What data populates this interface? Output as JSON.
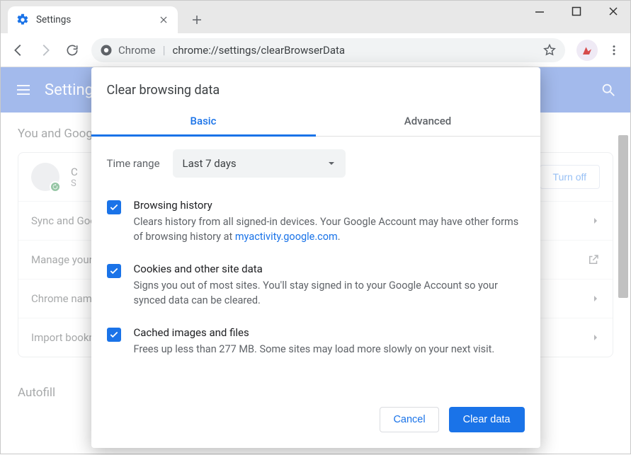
{
  "window": {
    "tab_title": "Settings"
  },
  "toolbar": {
    "url_prefix": "Chrome",
    "url_path": "chrome://settings/clearBrowserData"
  },
  "bluebar": {
    "title": "Settings"
  },
  "page": {
    "section_title": "You and Google",
    "profile_name_trunc": "C",
    "profile_sub_trunc": "S",
    "turn_off_label": "Turn off",
    "rows": [
      {
        "label": "Sync and Google services"
      },
      {
        "label": "Manage your Google Account"
      },
      {
        "label": "Chrome name and picture"
      },
      {
        "label": "Import bookmarks and settings"
      }
    ],
    "autofill_title": "Autofill"
  },
  "dialog": {
    "title": "Clear browsing data",
    "tabs": {
      "basic": "Basic",
      "advanced": "Advanced"
    },
    "time_range_label": "Time range",
    "time_range_value": "Last 7 days",
    "options": [
      {
        "title": "Browsing history",
        "desc_a": "Clears history from all signed-in devices. Your Google Account may have other forms of browsing history at ",
        "link": "myactivity.google.com",
        "desc_b": "."
      },
      {
        "title": "Cookies and other site data",
        "desc_a": "Signs you out of most sites. You'll stay signed in to your Google Account so your synced data can be cleared.",
        "link": "",
        "desc_b": ""
      },
      {
        "title": "Cached images and files",
        "desc_a": "Frees up less than 277 MB. Some sites may load more slowly on your next visit.",
        "link": "",
        "desc_b": ""
      }
    ],
    "cancel_label": "Cancel",
    "clear_label": "Clear data"
  }
}
